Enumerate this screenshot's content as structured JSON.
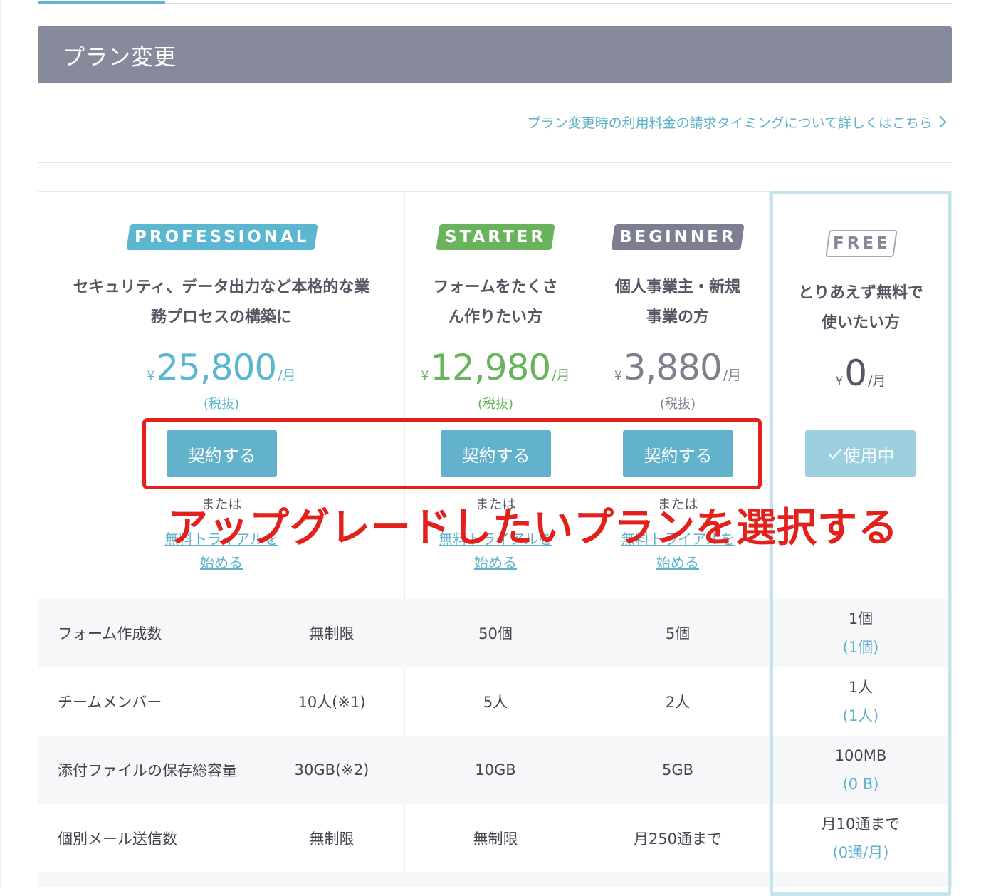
{
  "page": {
    "title": "プラン変更",
    "billing_link": "プラン変更時の利用料金の請求タイミングについて詳しくはこちら"
  },
  "annotation": {
    "text": "アップグレードしたいプランを選択する",
    "color": "#e2211c"
  },
  "plans": [
    {
      "badge": "PROFESSIONAL",
      "badge_color": "#5bb6d0",
      "desc_line1": "セキュリティ、データ出力など本格的な業",
      "desc_line2": "務プロセスの構築に",
      "currency": "¥",
      "price": "25,800",
      "per": "/月",
      "tax": "(税抜)",
      "button": "契約する",
      "or": "または",
      "trial_line1": "無料トライアルを",
      "trial_line2": "始める"
    },
    {
      "badge": "STARTER",
      "badge_color": "#69b35d",
      "desc_line1": "フォームをたくさ",
      "desc_line2": "ん作りたい方",
      "currency": "¥",
      "price": "12,980",
      "per": "/月",
      "tax": "(税抜)",
      "button": "契約する",
      "or": "または",
      "trial_line1": "無料トライアルを",
      "trial_line2": "始める"
    },
    {
      "badge": "BEGINNER",
      "badge_color": "#7d7f90",
      "desc_line1": "個人事業主・新規",
      "desc_line2": "事業の方",
      "currency": "¥",
      "price": "3,880",
      "per": "/月",
      "tax": "(税抜)",
      "button": "契約する",
      "or": "または",
      "trial_line1": "無料トライアルを",
      "trial_line2": "始める"
    },
    {
      "badge": "FREE",
      "badge_color": "#a4a6b3",
      "desc_line1": "とりあえず無料で",
      "desc_line2": "使いたい方",
      "currency": "¥",
      "price": "0",
      "per": "/月",
      "button": "使用中",
      "button_icon": "check-icon"
    }
  ],
  "features": [
    {
      "label": "フォーム作成数",
      "professional": "無制限",
      "starter": "50個",
      "beginner": "5個",
      "free": "1個",
      "free_usage": "(1個)"
    },
    {
      "label": "チームメンバー",
      "professional": "10人(※1)",
      "starter": "5人",
      "beginner": "2人",
      "free": "1人",
      "free_usage": "(1人)"
    },
    {
      "label": "添付ファイルの保存総容量",
      "professional": "30GB(※2)",
      "starter": "10GB",
      "beginner": "5GB",
      "free": "100MB",
      "free_usage": "(0 B)"
    },
    {
      "label": "個別メール送信数",
      "professional": "無制限",
      "starter": "無制限",
      "beginner": "月250通まで",
      "free": "月10通まで",
      "free_usage": "(0通/月)"
    }
  ],
  "colors": {
    "header_bg": "#878a9b",
    "accent_blue": "#5fb2cb",
    "starter_green": "#69b35d",
    "beginner_gray": "#7d7f90",
    "free_frame": "#c4e4ed"
  }
}
